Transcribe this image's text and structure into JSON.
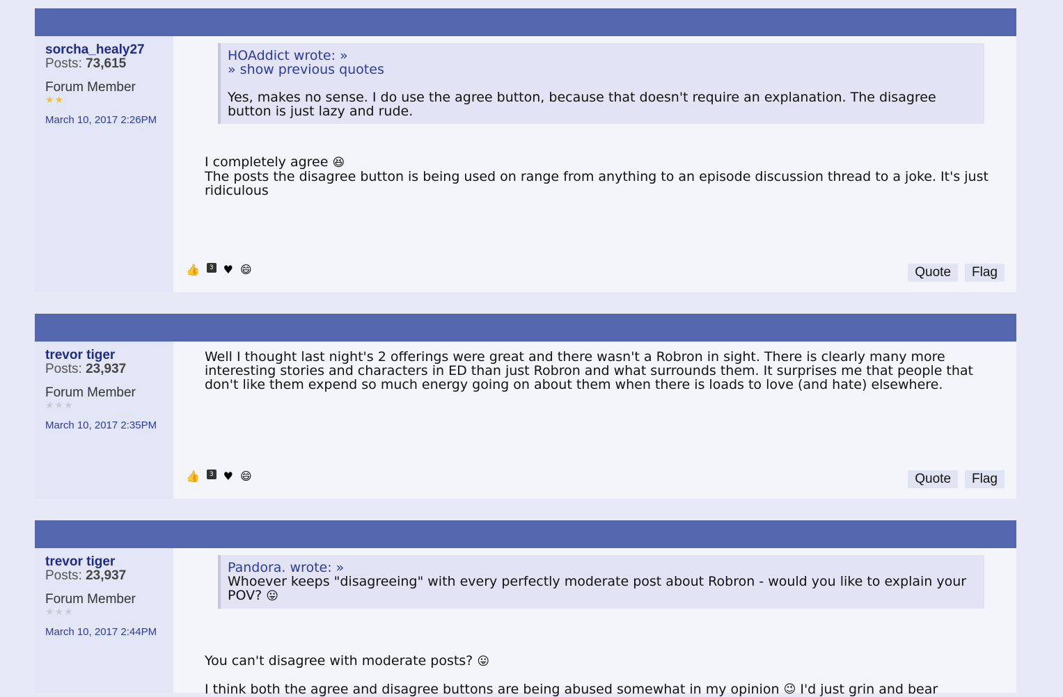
{
  "posts": [
    {
      "author": "sorcha_healy27",
      "posts_label": "Posts:",
      "posts_count": "73,615",
      "role": "Forum Member",
      "stars_on": "★★",
      "stars_off": "",
      "date": "March 10, 2017 2:26PM",
      "quote": {
        "attribution": "HOAddict wrote: »",
        "show_previous": "» show previous quotes",
        "text": "Yes, makes no sense. I do use the agree button, because that doesn't require an explanation. The disagree button is just lazy and rude."
      },
      "text_lines": [
        "I completely agree",
        "The posts the disagree button is being used on range from anything to an episode discussion thread to a joke. It's just ridiculous"
      ],
      "reactions": {
        "agree_icon": "thumbs-up-icon",
        "count": "3",
        "love_icon": "heart-icon",
        "lol_icon": "laugh-icon"
      },
      "quote_btn": "Quote",
      "flag_btn": "Flag"
    },
    {
      "author": "trevor tiger",
      "posts_label": "Posts:",
      "posts_count": "23,937",
      "role": "Forum Member",
      "stars_on": "",
      "stars_off": "★★★",
      "date": "March 10, 2017 2:35PM",
      "text": "Well I thought last night's 2 offerings were great and there wasn't a Robron in sight. There is clearly many more interesting stories and characters in ED than just Robron and what surrounds them. It surprises me that people that don't like them expend so much energy going on about them when there is loads to love (and hate) elsewhere.",
      "reactions": {
        "count": "3"
      },
      "quote_btn": "Quote",
      "flag_btn": "Flag"
    },
    {
      "author": "trevor tiger",
      "posts_label": "Posts:",
      "posts_count": "23,937",
      "role": "Forum Member",
      "stars_on": "",
      "stars_off": "★★★",
      "date": "March 10, 2017 2:44PM",
      "quote": {
        "attribution": "Pandora. wrote: »",
        "text": "Whoever keeps \"disagreeing\" with every perfectly moderate post about Robron - would you like to explain your POV?"
      },
      "text_line1": "You can't disagree with moderate posts?",
      "text_line2a": "I think both the agree and disagree buttons are being abused somewhat in my opinion",
      "text_line2b": "I'd just grin and bear"
    }
  ]
}
